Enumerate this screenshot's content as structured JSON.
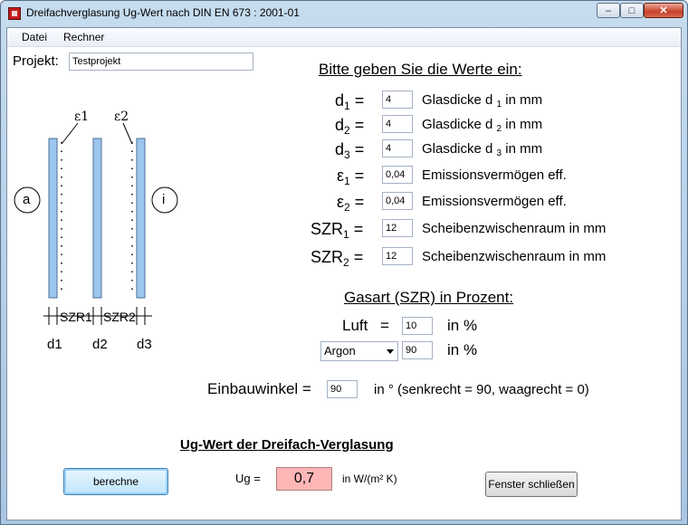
{
  "window": {
    "title": "Dreifachverglasung Ug-Wert nach DIN EN 673 : 2001-01",
    "minimize": "–",
    "maximize": "□",
    "close": "✕"
  },
  "menu": {
    "items": [
      "Datei",
      "Rechner"
    ]
  },
  "project": {
    "label": "Projekt:",
    "value": "Testprojekt"
  },
  "diagram": {
    "outside": "a",
    "inside": "i",
    "eps1": "ε1",
    "eps2": "ε2",
    "szr1": "SZR1",
    "szr2": "SZR2",
    "d1": "d1",
    "d2": "d2",
    "d3": "d3"
  },
  "inputs": {
    "heading": "Bitte geben Sie die Werte ein:",
    "rows": [
      {
        "sym": "d",
        "sub": "1",
        "value": "4",
        "desc": "Glasdicke d",
        "desc_sub": "1",
        "desc_tail": " in mm"
      },
      {
        "sym": "d",
        "sub": "2",
        "value": "4",
        "desc": "Glasdicke d",
        "desc_sub": "2",
        "desc_tail": " in mm"
      },
      {
        "sym": "d",
        "sub": "3",
        "value": "4",
        "desc": "Glasdicke d",
        "desc_sub": "3",
        "desc_tail": " in mm"
      },
      {
        "sym": "ε",
        "sub": "1",
        "value": "0,04",
        "desc": "Emissionsvermögen eff.",
        "desc_sub": "",
        "desc_tail": ""
      },
      {
        "sym": "ε",
        "sub": "2",
        "value": "0,04",
        "desc": "Emissionsvermögen eff.",
        "desc_sub": "",
        "desc_tail": ""
      },
      {
        "sym": "SZR",
        "sub": "1",
        "value": "12",
        "desc": "Scheibenzwischenraum in mm",
        "desc_sub": "",
        "desc_tail": ""
      },
      {
        "sym": "SZR",
        "sub": "2",
        "value": "12",
        "desc": "Scheibenzwischenraum in mm",
        "desc_sub": "",
        "desc_tail": ""
      }
    ],
    "equals": "="
  },
  "gas": {
    "heading": "Gasart (SZR) in Prozent:",
    "luft_label": "Luft",
    "equals": "=",
    "luft_value": "10",
    "unit": "in %",
    "select_value": "Argon",
    "select_percent": "90"
  },
  "angle": {
    "label": "Einbauwinkel =",
    "value": "90",
    "hint": "in ° (senkrecht = 90, waagrecht = 0)"
  },
  "result": {
    "heading": "Ug-Wert der Dreifach-Verglasung",
    "calc_button": "berechne",
    "ug_label": "Ug =",
    "ug_value": "0,7",
    "ug_unit": "in W/(m² K)",
    "close_button": "Fenster schließen"
  }
}
